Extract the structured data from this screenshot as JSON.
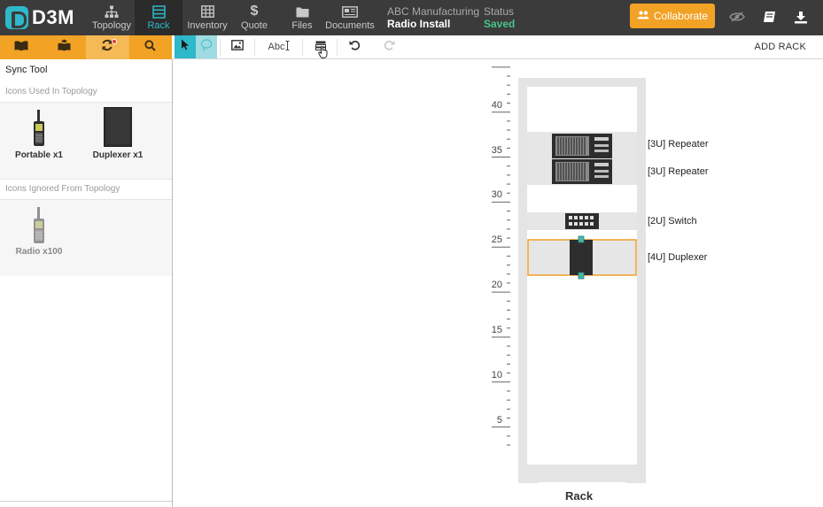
{
  "app": {
    "logo_text": "D3M"
  },
  "nav": {
    "items": [
      {
        "key": "topology",
        "label": "Topology",
        "icon": "topology-icon"
      },
      {
        "key": "rack",
        "label": "Rack",
        "icon": "rack-icon",
        "active": true
      },
      {
        "key": "inventory",
        "label": "Inventory",
        "icon": "inventory-icon"
      },
      {
        "key": "quote",
        "label": "Quote",
        "icon": "dollar-icon"
      },
      {
        "key": "files",
        "label": "Files",
        "icon": "folder-icon"
      },
      {
        "key": "documents",
        "label": "Documents",
        "icon": "documents-icon"
      }
    ],
    "project_org": "ABC Manufacturing",
    "project_name": "Radio Install",
    "status_label": "Status",
    "status_value": "Saved",
    "collaborate_label": "Collaborate"
  },
  "colors": {
    "accent_orange": "#f2a225",
    "accent_teal": "#2fb8c9",
    "status_green": "#47c48a",
    "topbar": "#3b3b3b"
  },
  "left_panel": {
    "title": "Sync Tool",
    "used_title": "Icons Used In Topology",
    "used_items": [
      {
        "label": "Portable x1",
        "icon": "portable-radio-icon"
      },
      {
        "label": "Duplexer x1",
        "icon": "duplexer-icon"
      }
    ],
    "ignored_title": "Icons Ignored From Topology",
    "ignored_items": [
      {
        "label": "Radio x100",
        "icon": "radio-icon"
      }
    ]
  },
  "toolbar": {
    "text_tool_label": "Abc",
    "add_rack_label": "ADD RACK"
  },
  "rack": {
    "name": "Rack",
    "scale_labels": [
      "40",
      "35",
      "30",
      "25",
      "20",
      "15",
      "10",
      "5"
    ],
    "devices": [
      {
        "label": "[3U] Repeater",
        "type": "repeater"
      },
      {
        "label": "[3U] Repeater",
        "type": "repeater"
      },
      {
        "label": "[2U] Switch",
        "type": "switch"
      },
      {
        "label": "[4U] Duplexer",
        "type": "duplexer",
        "selected": true
      }
    ]
  }
}
